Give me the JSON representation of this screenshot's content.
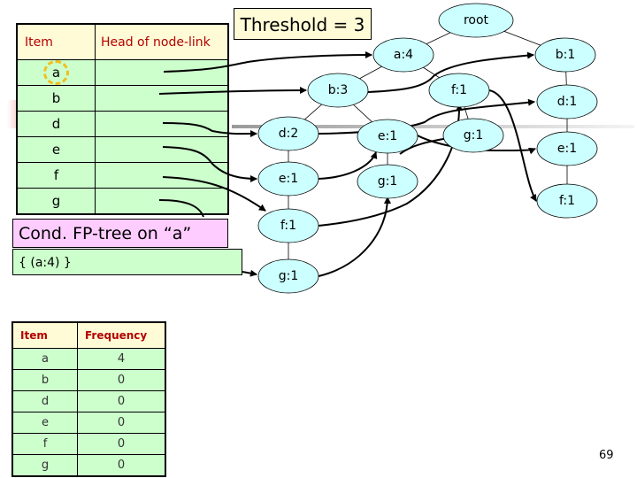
{
  "header_table": {
    "columns": [
      "Item",
      "Head of node-link"
    ],
    "items": [
      "a",
      "b",
      "d",
      "e",
      "f",
      "g"
    ],
    "highlighted_item": "a"
  },
  "threshold_label": "Threshold = 3",
  "conditional_tree": {
    "title": "Cond. FP-tree on “a”",
    "content": "{ (a:4)  }"
  },
  "frequency_table": {
    "columns": [
      "Item",
      "Frequency"
    ],
    "rows": [
      {
        "item": "a",
        "frequency": "4"
      },
      {
        "item": "b",
        "frequency": "0"
      },
      {
        "item": "d",
        "frequency": "0"
      },
      {
        "item": "e",
        "frequency": "0"
      },
      {
        "item": "f",
        "frequency": "0"
      },
      {
        "item": "g",
        "frequency": "0"
      }
    ]
  },
  "tree": {
    "nodes": [
      {
        "id": "root",
        "label": "root"
      },
      {
        "id": "a4",
        "label": "a:4"
      },
      {
        "id": "b1r",
        "label": "b:1"
      },
      {
        "id": "b3",
        "label": "b:3"
      },
      {
        "id": "f1a",
        "label": "f:1"
      },
      {
        "id": "d1",
        "label": "d:1"
      },
      {
        "id": "d2",
        "label": "d:2"
      },
      {
        "id": "e1b",
        "label": "e:1"
      },
      {
        "id": "g1f",
        "label": "g:1"
      },
      {
        "id": "e1d",
        "label": "e:1"
      },
      {
        "id": "e1r",
        "label": "e:1"
      },
      {
        "id": "g1e",
        "label": "g:1"
      },
      {
        "id": "f1r",
        "label": "f:1"
      },
      {
        "id": "f1d",
        "label": "f:1"
      },
      {
        "id": "g1d",
        "label": "g:1"
      }
    ],
    "edges": [
      [
        "root",
        "a4"
      ],
      [
        "root",
        "b1r"
      ],
      [
        "a4",
        "b3"
      ],
      [
        "a4",
        "f1a"
      ],
      [
        "b1r",
        "d1"
      ],
      [
        "b3",
        "d2"
      ],
      [
        "b3",
        "e1b"
      ],
      [
        "f1a",
        "g1f"
      ],
      [
        "d1",
        "e1r"
      ],
      [
        "d2",
        "e1d"
      ],
      [
        "e1b",
        "g1e"
      ],
      [
        "e1r",
        "f1r"
      ],
      [
        "e1d",
        "f1d"
      ],
      [
        "f1d",
        "g1d"
      ]
    ]
  },
  "page_number": "69",
  "colors": {
    "node_fill": "#ccffff",
    "header_fill": "#fffbd6",
    "row_fill": "#ccffcc",
    "cond_title_fill": "#ffccff",
    "header_text": "#b30000",
    "highlight": "#f0c020"
  }
}
